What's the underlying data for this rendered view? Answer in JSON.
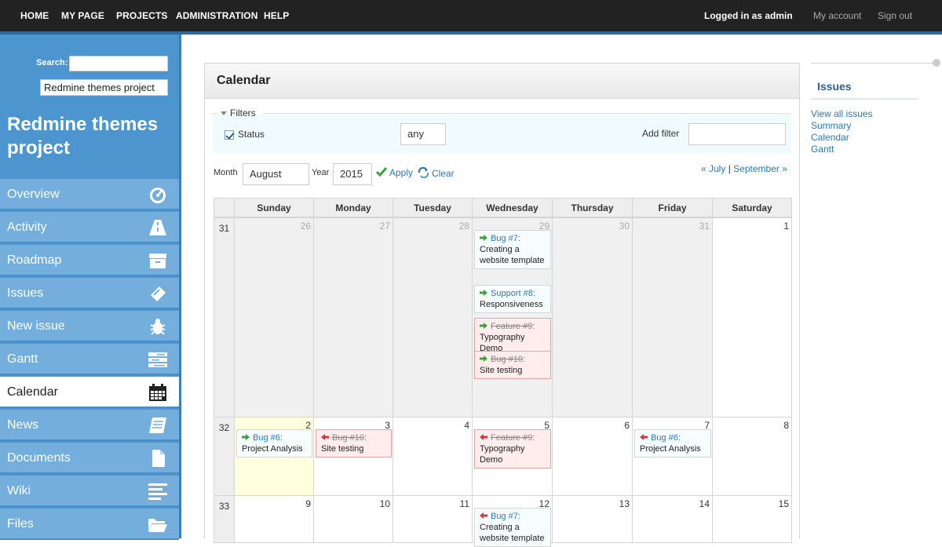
{
  "topnav": {
    "home": "HOME",
    "my_page": "MY PAGE",
    "projects": "PROJECTS",
    "administration": "ADMINISTRATION",
    "help": "HELP",
    "logged_in_prefix": "Logged in as",
    "user": "admin",
    "my_account": "My account",
    "sign_out": "Sign out"
  },
  "sidebar": {
    "search_label": "Search:",
    "search_value": "",
    "project_jump": "Redmine themes project",
    "project_title": "Redmine themes project",
    "menu": [
      {
        "label": "Overview",
        "icon": "dashboard-icon"
      },
      {
        "label": "Activity",
        "icon": "road-icon"
      },
      {
        "label": "Roadmap",
        "icon": "archive-box-icon"
      },
      {
        "label": "Issues",
        "icon": "ticket-icon"
      },
      {
        "label": "New issue",
        "icon": "bug-icon"
      },
      {
        "label": "Gantt",
        "icon": "gantt-bars-icon"
      },
      {
        "label": "Calendar",
        "icon": "calendar-icon",
        "selected": true
      },
      {
        "label": "News",
        "icon": "newspaper-icon"
      },
      {
        "label": "Documents",
        "icon": "document-icon"
      },
      {
        "label": "Wiki",
        "icon": "lines-icon"
      },
      {
        "label": "Files",
        "icon": "folder-icon"
      }
    ]
  },
  "content": {
    "title": "Calendar",
    "filters": {
      "legend": "Filters",
      "status_label": "Status",
      "status_checked": true,
      "status_value": "any",
      "add_filter_label": "Add filter",
      "add_filter_value": ""
    },
    "controls": {
      "month_label": "Month",
      "month_value": "August",
      "year_label": "Year",
      "year_value": "2015",
      "apply": "Apply",
      "clear": "Clear",
      "prev": "« July",
      "separator": "|",
      "next": "September »"
    },
    "calendar": {
      "weekdays": [
        "Sunday",
        "Monday",
        "Tuesday",
        "Wednesday",
        "Thursday",
        "Friday",
        "Saturday"
      ],
      "weeks": [
        {
          "number": "31",
          "days": [
            {
              "n": "26",
              "other": true
            },
            {
              "n": "27",
              "other": true
            },
            {
              "n": "28",
              "other": true
            },
            {
              "n": "29",
              "other": true,
              "issues": [
                {
                  "tracker": "Bug #7",
                  "subject": "Creating a website template",
                  "closed": false,
                  "dir": "start"
                },
                {
                  "tracker": "Support #8",
                  "subject": "Responsiveness",
                  "closed": false,
                  "dir": "start"
                },
                {
                  "tracker": "Feature #9",
                  "subject": "Typography Demo",
                  "closed": true,
                  "dir": "start"
                },
                {
                  "tracker": "Bug #10",
                  "subject": "Site testing",
                  "closed": true,
                  "dir": "start"
                }
              ]
            },
            {
              "n": "30",
              "other": true
            },
            {
              "n": "31",
              "other": true
            },
            {
              "n": "1"
            }
          ]
        },
        {
          "number": "32",
          "days": [
            {
              "n": "2",
              "today": true,
              "issues": [
                {
                  "tracker": "Bug #6",
                  "subject": "Project Analysis",
                  "closed": false,
                  "dir": "start"
                }
              ]
            },
            {
              "n": "3",
              "issues": [
                {
                  "tracker": "Bug #10",
                  "subject": "Site testing",
                  "closed": true,
                  "dir": "end"
                }
              ]
            },
            {
              "n": "4"
            },
            {
              "n": "5",
              "issues": [
                {
                  "tracker": "Feature #9",
                  "subject": "Typography Demo",
                  "closed": true,
                  "dir": "end"
                }
              ]
            },
            {
              "n": "6"
            },
            {
              "n": "7",
              "issues": [
                {
                  "tracker": "Bug #6",
                  "subject": "Project Analysis",
                  "closed": false,
                  "dir": "end"
                }
              ]
            },
            {
              "n": "8"
            }
          ]
        },
        {
          "number": "33",
          "days": [
            {
              "n": "9"
            },
            {
              "n": "10"
            },
            {
              "n": "11"
            },
            {
              "n": "12",
              "issues": [
                {
                  "tracker": "Bug #7",
                  "subject": "Creating a website template",
                  "closed": false,
                  "dir": "end"
                }
              ]
            },
            {
              "n": "13"
            },
            {
              "n": "14"
            },
            {
              "n": "15"
            }
          ]
        }
      ]
    }
  },
  "right_sidebar": {
    "heading": "Issues",
    "links": [
      "View all issues",
      "Summary",
      "Calendar",
      "Gantt"
    ]
  },
  "colors": {
    "topbar": "#222222",
    "sidebar": "#4d95cf",
    "menu_item": "#74aedc",
    "link": "#2a7ab8",
    "today": "#ffffdd",
    "closed_issue": "#ffeded",
    "arrow_start": "#3aa33a",
    "arrow_end": "#d23a3a"
  }
}
